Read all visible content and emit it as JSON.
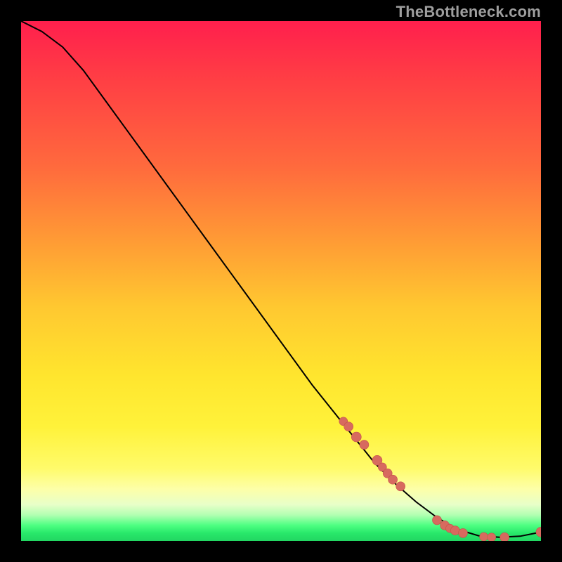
{
  "watermark": "TheBottleneck.com",
  "colors": {
    "curve_stroke": "#000000",
    "dot_fill": "#d76a5f",
    "dot_stroke": "#c55248",
    "background": "#000000"
  },
  "chart_data": {
    "type": "line",
    "title": "",
    "xlabel": "",
    "ylabel": "",
    "xlim": [
      0,
      100
    ],
    "ylim": [
      0,
      100
    ],
    "grid": false,
    "legend": false,
    "series": [
      {
        "name": "curve",
        "x": [
          0,
          4,
          8,
          12,
          16,
          20,
          24,
          28,
          32,
          36,
          40,
          44,
          48,
          52,
          56,
          60,
          64,
          68,
          72,
          76,
          80,
          84,
          88,
          92,
          96,
          100
        ],
        "y": [
          100,
          98,
          95,
          90.5,
          85,
          79.5,
          74,
          68.5,
          63,
          57.5,
          52,
          46.5,
          41,
          35.5,
          30,
          25,
          20,
          15,
          11,
          7.5,
          4.5,
          2.2,
          1,
          0.7,
          0.9,
          1.7
        ]
      }
    ],
    "scatter": [
      {
        "name": "highlighted-points",
        "x": [
          62,
          63,
          64.5,
          66,
          68.5,
          69.5,
          70.5,
          71.5,
          73,
          80,
          81.5,
          82.5,
          83.5,
          85,
          89,
          90.5,
          93,
          100
        ],
        "y": [
          23,
          22,
          20,
          18.5,
          15.5,
          14.2,
          13,
          11.8,
          10.5,
          4,
          3,
          2.4,
          2,
          1.5,
          0.8,
          0.7,
          0.7,
          1.7
        ],
        "r": [
          6,
          6.5,
          7,
          6.5,
          7,
          6,
          6.5,
          6.5,
          6.5,
          6.5,
          6.5,
          6,
          6.5,
          6.5,
          6,
          6,
          6.5,
          7
        ]
      }
    ]
  }
}
